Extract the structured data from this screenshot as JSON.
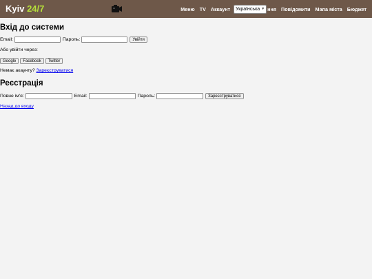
{
  "header": {
    "logo_main": "Kyiv ",
    "logo_accent": "24/7",
    "nav": {
      "menu": "Меню",
      "tv": "TV",
      "account": "Аккаунт",
      "language_selected": "Українська",
      "hidden_tail": "ння",
      "notify": "Повідомити",
      "city_map": "Мапа міста",
      "budget": "Бюджет"
    }
  },
  "login": {
    "title": "Вхід до системи",
    "email_label": "Email:",
    "password_label": "Пароль:",
    "submit_label": "Увійти",
    "social_prompt": "Або увійти через:",
    "social": [
      "Google",
      "Facebook",
      "Twitter"
    ],
    "no_account_text": "Немає акаунту?",
    "register_link": "Зареєструватися"
  },
  "register": {
    "title": "Реєстрація",
    "fullname_label": "Повне ім'я:",
    "email_label": "Email:",
    "password_label": "Пароль:",
    "submit_label": "Зареєструватися",
    "back_link": "Назад до входу"
  },
  "colors": {
    "topbar": "#6e5849",
    "logo_accent": "#b6e13a",
    "link": "#0000ee",
    "page_background": "#f3f3f3"
  }
}
